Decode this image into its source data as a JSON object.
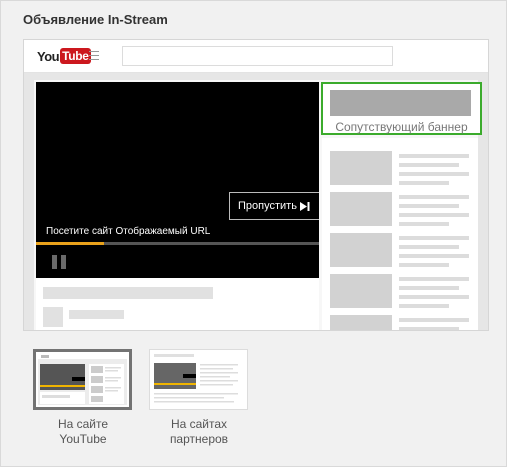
{
  "panel": {
    "title": "Объявление In-Stream"
  },
  "mock": {
    "logo": {
      "you": "You",
      "tube": "Tube"
    },
    "player": {
      "visit_text": "Посетите сайт Отображаемый URL",
      "skip_label": "Пропустить",
      "progress_fraction": 0.24
    },
    "companion_label": "Сопутствующий баннер"
  },
  "options": [
    {
      "line1": "На сайте",
      "line2": "YouTube",
      "selected": true
    },
    {
      "line1": "На сайтах",
      "line2": "партнеров",
      "selected": false
    }
  ],
  "colors": {
    "companion_border": "#3bab2c",
    "progress": "#e9a21c",
    "youtube_red": "#cc181e"
  }
}
